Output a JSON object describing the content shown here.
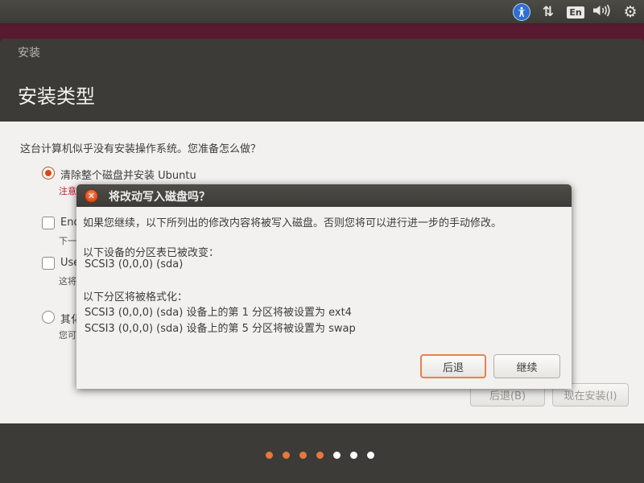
{
  "top_panel": {
    "icons": [
      "accessibility-icon",
      "network-icon",
      "keyboard-layout-icon",
      "volume-icon",
      "session-gear-icon"
    ],
    "keyboard_layout": "En",
    "accent_color": "#2f6fd1"
  },
  "window": {
    "title": "安装",
    "page_title": "安装类型"
  },
  "installer": {
    "question": "这台计算机似乎没有安装操作系统。您准备怎么做？",
    "options": [
      {
        "label": "清除整个磁盘并安装 Ubuntu",
        "sub": "注意",
        "type": "radio",
        "checked": true
      },
      {
        "label": "End",
        "sub": "下一",
        "type": "checkbox",
        "checked": false
      },
      {
        "label": "Use",
        "sub": "这将",
        "type": "checkbox",
        "checked": false
      },
      {
        "label": "其化",
        "sub": "您可",
        "type": "radio",
        "checked": false
      }
    ],
    "back_label": "后退(B)",
    "install_label": "现在安装(I)",
    "progress": {
      "total": 7,
      "completed": 4,
      "active_color": "#e5783d"
    }
  },
  "dialog": {
    "title": "将改动写入磁盘吗？",
    "intro": "如果您继续，以下所列出的修改内容将被写入磁盘。否则您将可以进行进一步的手动修改。",
    "partition_table_heading": "以下设备的分区表已被改变：",
    "partition_table_devices": [
      "SCSI3 (0,0,0) (sda)"
    ],
    "format_heading": "以下分区将被格式化：",
    "format_items": [
      "SCSI3 (0,0,0) (sda) 设备上的第 1 分区将被设置为 ext4",
      "SCSI3 (0,0,0) (sda) 设备上的第 5 分区将被设置为 swap"
    ],
    "back_label": "后退",
    "continue_label": "继续",
    "close_color": "#df4b16"
  }
}
